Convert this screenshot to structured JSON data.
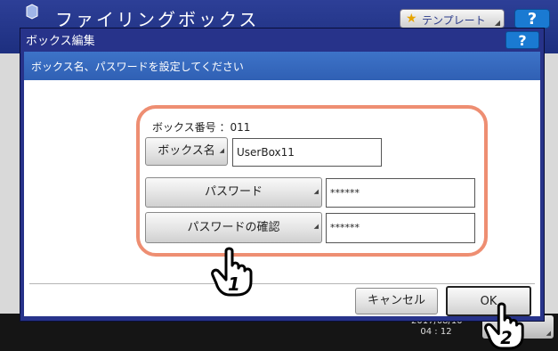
{
  "background": {
    "title": "ファイリングボックス",
    "template_button": "テンプレート",
    "help_label": "?",
    "datetime": [
      "2017/08/10",
      "04 : 12"
    ]
  },
  "dialog": {
    "title": "ボックス編集",
    "help_label": "?",
    "message": "ボックス名、パスワードを設定してください",
    "box_number_label": "ボックス番号 ：011",
    "box_name_button": "ボックス名",
    "box_name_value": "UserBox11",
    "password_button": "パスワード",
    "password_value": "******",
    "password_confirm_button": "パスワードの確認",
    "password_confirm_value": "******",
    "cancel_button": "キャンセル",
    "ok_button": "OK"
  },
  "annotations": {
    "step1": "1",
    "step2": "2"
  },
  "colors": {
    "dialog_frame": "#27338a",
    "message_bar": "#3d73c8",
    "highlight": "#ee8e72",
    "help_button": "#1a7ad2"
  }
}
